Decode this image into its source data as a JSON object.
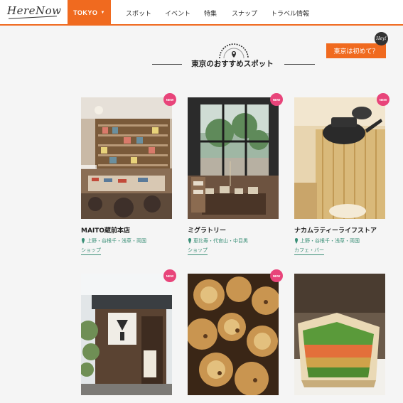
{
  "header": {
    "logo": "HereNow",
    "city": "TOKYO",
    "nav": [
      "スポット",
      "イベント",
      "特集",
      "スナップ",
      "トラベル情報"
    ]
  },
  "cta": {
    "label": "東京は初めて？",
    "badge": "Hey!"
  },
  "section": {
    "title": "東京のおすすめスポット"
  },
  "cards": [
    {
      "title": "MAITO蔵前本店",
      "area": "上野・谷根千・浅草・両国",
      "category": "ショップ",
      "badge": "NEW"
    },
    {
      "title": "ミグラトリー",
      "area": "恵比寿・代官山・中目黒",
      "category": "ショップ",
      "badge": "NEW"
    },
    {
      "title": "ナカムラティーライフストア",
      "area": "上野・谷根千・浅草・両国",
      "category": "カフェ・バー",
      "badge": "NEW"
    },
    {
      "title": "",
      "area": "",
      "category": "",
      "badge": "NEW"
    },
    {
      "title": "",
      "area": "",
      "category": "",
      "badge": "NEW"
    },
    {
      "title": "",
      "area": "",
      "category": "",
      "badge": ""
    }
  ],
  "colors": {
    "accent": "#f06a1f",
    "new_badge": "#e8447a",
    "area_text": "#3a8f77"
  }
}
